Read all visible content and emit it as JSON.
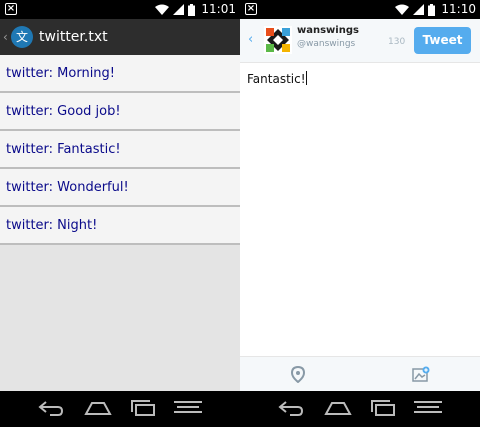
{
  "left": {
    "status": {
      "time": "11:01"
    },
    "title": "twitter.txt",
    "app_icon_glyph": "文",
    "items": [
      {
        "text": "twitter: Morning!"
      },
      {
        "text": "twitter: Good job!"
      },
      {
        "text": "twitter: Fantastic!"
      },
      {
        "text": "twitter: Wonderful!"
      },
      {
        "text": "twitter: Night!"
      }
    ]
  },
  "right": {
    "status": {
      "time": "11:10"
    },
    "username": "wanswings",
    "handle": "@wanswings",
    "char_count": "130",
    "tweet_label": "Tweet",
    "compose_text": "Fantastic!"
  },
  "colors": {
    "twitter_blue": "#55acee",
    "list_text": "#0a0a8a",
    "actionbar": "#2d2d2d",
    "app_icon": "#1f78b4"
  },
  "icons": [
    "back-icon",
    "home-icon",
    "recents-icon",
    "menu-icon",
    "location-pin-icon",
    "add-image-icon",
    "wifi-icon",
    "signal-icon",
    "battery-icon"
  ]
}
